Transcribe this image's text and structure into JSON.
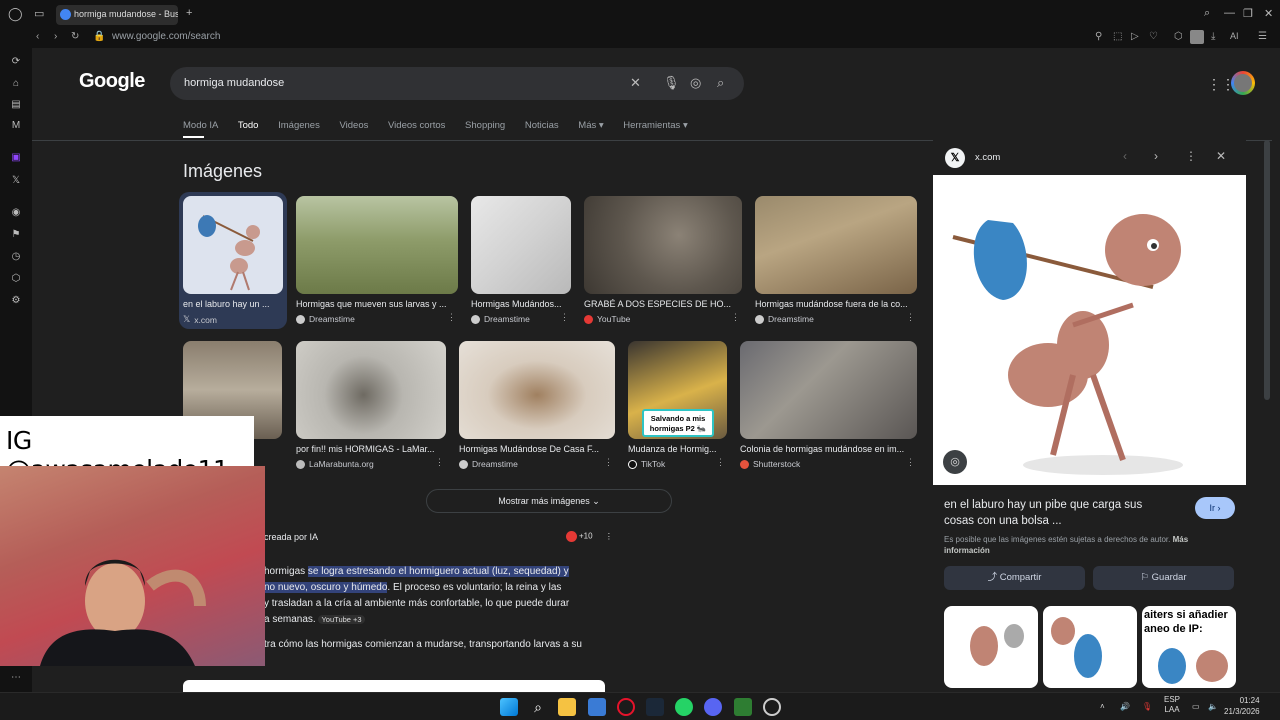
{
  "browser": {
    "tab_title": "hormiga mudandose - Bus",
    "url": "www.google.com/search",
    "ai_label": "AI"
  },
  "google": {
    "logo": "Google",
    "query": "hormiga mudandose",
    "tabs": [
      "Modo IA",
      "Todo",
      "Imágenes",
      "Videos",
      "Videos cortos",
      "Shopping",
      "Noticias",
      "Más ▾",
      "Herramientas ▾"
    ]
  },
  "images_section": {
    "title": "Imágenes",
    "row1": [
      {
        "caption": "en el laburo hay un ...",
        "source": "x.com"
      },
      {
        "caption": "Hormigas que mueven sus larvas y ...",
        "source": "Dreamstime"
      },
      {
        "caption": "Hormigas Mudándos...",
        "source": "Dreamstime"
      },
      {
        "caption": "GRABÉ A DOS ESPECIES DE HO...",
        "source": "YouTube"
      },
      {
        "caption": "Hormigas mudándose fuera de la co...",
        "source": "Dreamstime"
      }
    ],
    "row2": [
      {
        "caption": "...dos...",
        "source": ""
      },
      {
        "caption": "por fin!! mis HORMIGAS - LaMar...",
        "source": "LaMarabunta.org"
      },
      {
        "caption": "Hormigas Mudándose De Casa F...",
        "source": "Dreamstime"
      },
      {
        "caption": "Mudanza de Hormig...",
        "source": "TikTok"
      },
      {
        "caption": "Colonia de hormigas mudándose en im...",
        "source": "Shutterstock"
      }
    ],
    "thumb_overlay_text": "Salvando a mis hormigas P2 🐜",
    "show_more": "Mostrar más imágenes"
  },
  "ai_overview": {
    "title": "creada por IA",
    "sources_count": "+10",
    "line1_pre": "hormigas ",
    "line1_hl": "se logra estresando el hormiguero actual (luz, sequedad) y",
    "line2_hl": "no nuevo, oscuro y húmedo",
    "line2_post": ". El proceso es voluntario; la reina y las",
    "line3": "y trasladan a la cría al ambiente más confortable, lo que puede durar",
    "line4": "a semanas.",
    "chip": "YouTube +3",
    "line5": "tra cómo las hormigas comienzan a mudarse, transportando larvas a su"
  },
  "panel": {
    "source": "x.com",
    "title": "en el laburo hay un pibe que carga sus cosas con una bolsa ...",
    "go": "Ir ›",
    "copyright": "Es posible que las imágenes estén sujetas a derechos de autor.",
    "more_info": "Más información",
    "share": "Compartir",
    "save": "Guardar",
    "related_text": "aiters si añadier\naneo de IP:"
  },
  "overlay": {
    "ig_handle": "IG @awasamelado11"
  },
  "taskbar": {
    "lang1": "ESP",
    "lang2": "LAA",
    "time": "01:24",
    "date": "21/3/2026"
  },
  "colors": {
    "accent_blue": "#a8c7fa",
    "highlight": "#33437a",
    "selected_card": "#2e3a55"
  }
}
